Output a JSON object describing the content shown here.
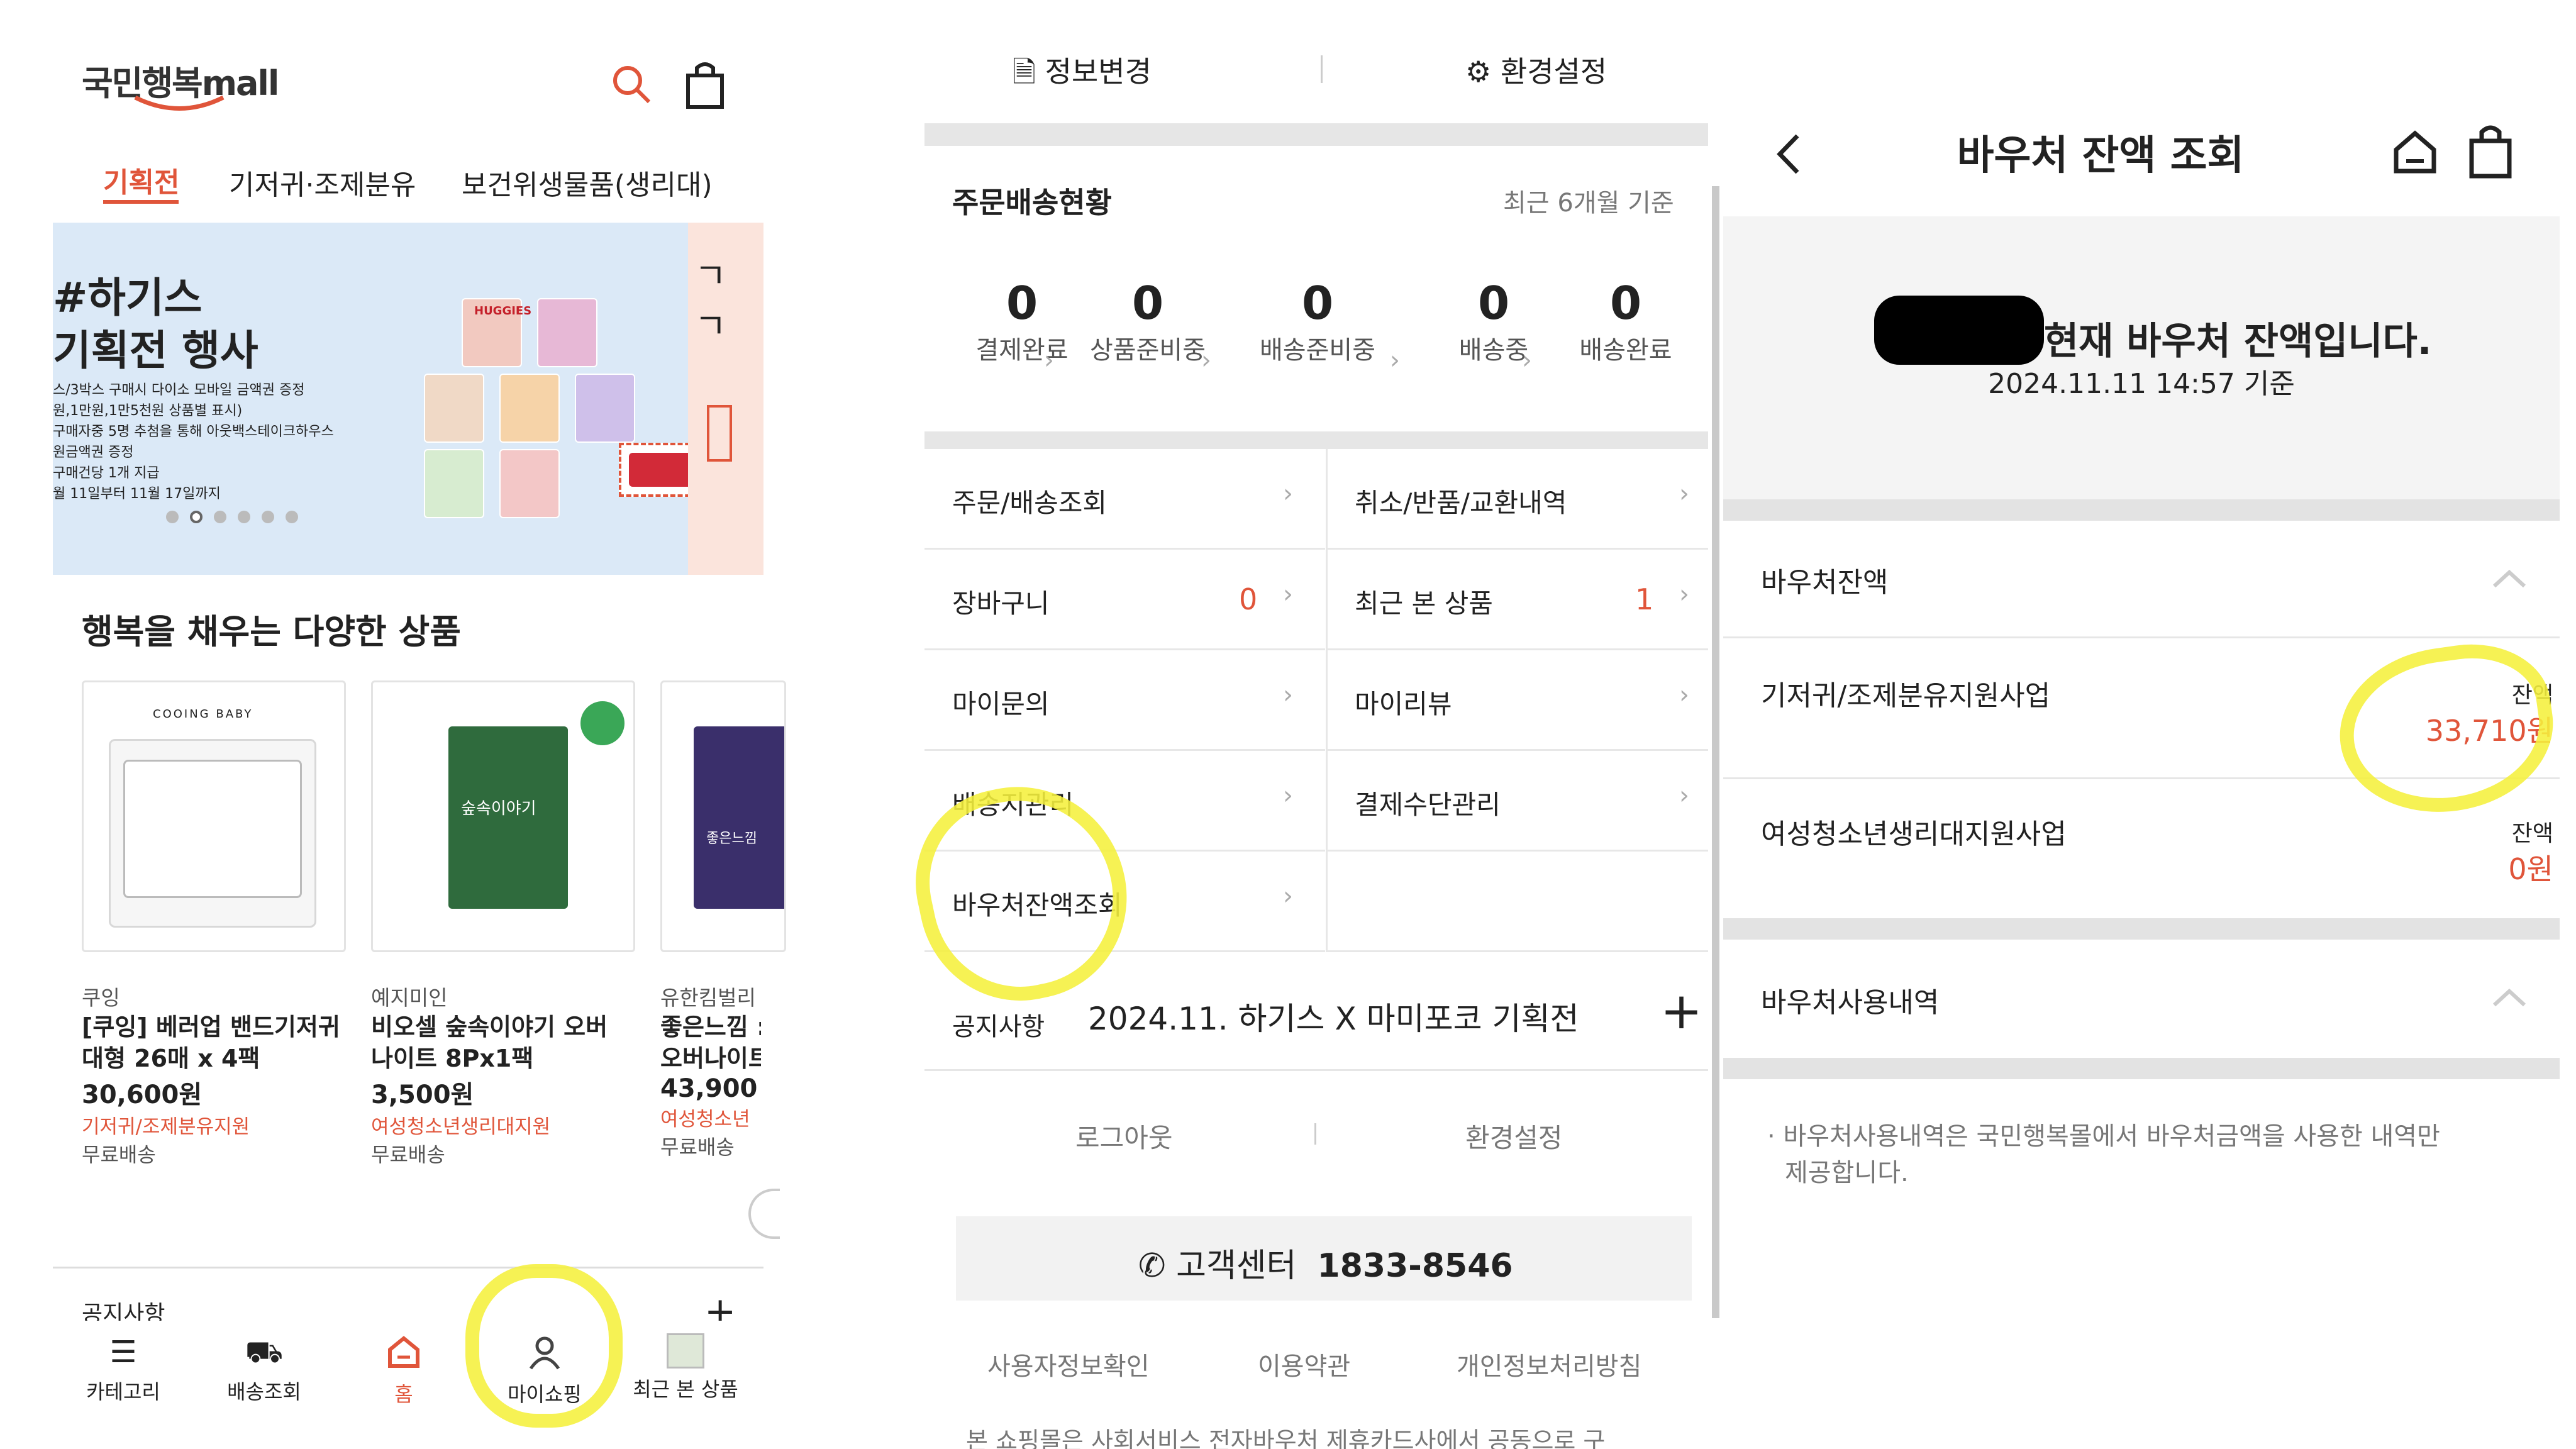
{
  "panel1": {
    "logo": "국민행복mall",
    "tabs": [
      "기획전",
      "기저귀·조제분유",
      "보건위생물품(생리대)"
    ],
    "banner": {
      "title1": "#하기스",
      "title2": "기획전 행사",
      "lines": [
        "스/3박스 구매시 다이소 모바일 금액권 증정",
        "원,1만원,1만5천원 상품별 표시)",
        "구매자중 5명 추첨을 통해 아웃백스테이크하우스",
        "원금액권 증정",
        "구매건당 1개 지급",
        "월 11일부터 11월 17일까지"
      ],
      "brand_mark": "HUGGIES",
      "dots_count": 6,
      "active_dot": 1
    },
    "section_title": "행복을 채우는 다양한 상품",
    "products": [
      {
        "brand": "쿠잉",
        "name1": "[쿠잉] 베러업 밴드기저귀",
        "name2": "대형 26매 x 4팩",
        "price": "30,600원",
        "tag": "기저귀/조제분유지원",
        "ship": "무료배송",
        "pack_label": "COOING BABY"
      },
      {
        "brand": "예지미인",
        "name1": "비오셀 숲속이야기 오버",
        "name2": "나이트 8Px1팩",
        "price": "3,500원",
        "tag": "여성청소년생리대지원",
        "ship": "무료배송",
        "pack_label": "숲속이야기"
      },
      {
        "brand": "유한킴벌리",
        "name1": "좋은느낌 :",
        "name2": "오버나이트",
        "price": "43,900",
        "tag": "여성청소년",
        "ship": "무료배송",
        "pack_label": "좋은느낌"
      }
    ],
    "notice_label": "공지사항",
    "bottom_nav": [
      "카테고리",
      "배송조회",
      "홈",
      "마이쇼핑",
      "최근 본 상품"
    ]
  },
  "panel2": {
    "top_buttons": [
      "정보변경",
      "환경설정"
    ],
    "order_title": "주문배송현황",
    "order_sub": "최근 6개월 기준",
    "status": [
      {
        "count": "0",
        "label": "결제완료"
      },
      {
        "count": "0",
        "label": "상품준비중"
      },
      {
        "count": "0",
        "label": "배송준비중"
      },
      {
        "count": "0",
        "label": "배송중"
      },
      {
        "count": "0",
        "label": "배송완료"
      }
    ],
    "menu": [
      {
        "label": "주문/배송조회",
        "count": ""
      },
      {
        "label": "취소/반품/교환내역",
        "count": ""
      },
      {
        "label": "장바구니",
        "count": "0"
      },
      {
        "label": "최근 본 상품",
        "count": "1"
      },
      {
        "label": "마이문의",
        "count": ""
      },
      {
        "label": "마이리뷰",
        "count": ""
      },
      {
        "label": "배송지관리",
        "count": ""
      },
      {
        "label": "결제수단관리",
        "count": ""
      },
      {
        "label": "바우처잔액조회",
        "count": ""
      }
    ],
    "notice_label": "공지사항",
    "notice_text": "2024.11. 하기스 X 마미포코 기획전",
    "logout": "로그아웃",
    "settings": "환경설정",
    "cs_label": "고객센터",
    "cs_phone": "1833-8546",
    "footer_links": [
      "사용자정보확인",
      "이용약관",
      "개인정보처리방침"
    ],
    "footer_text": "본 쇼핑몰은 사회서비스 전자바우처 제휴카드사에서 공동으로 구"
  },
  "panel3": {
    "title": "바우처 잔액 조회",
    "summary": "현재 바우처 잔액입니다.",
    "date": "2024.11.11  14:57 기준",
    "balance_section": "바우처잔액",
    "items": [
      {
        "name": "기저귀/조제분유지원사업",
        "label": "잔액",
        "amount": "33,710원"
      },
      {
        "name": "여성청소년생리대지원사업",
        "label": "잔액",
        "amount": "0원"
      }
    ],
    "usage_section": "바우처사용내역",
    "usage_note_1": "바우처사용내역은 국민행복몰에서 바우처금액을 사용한 내역만",
    "usage_note_2": "제공합니다."
  },
  "colors": {
    "accent": "#e0553a",
    "highlight": "#f5f03c",
    "divider": "#e6e6e6"
  }
}
